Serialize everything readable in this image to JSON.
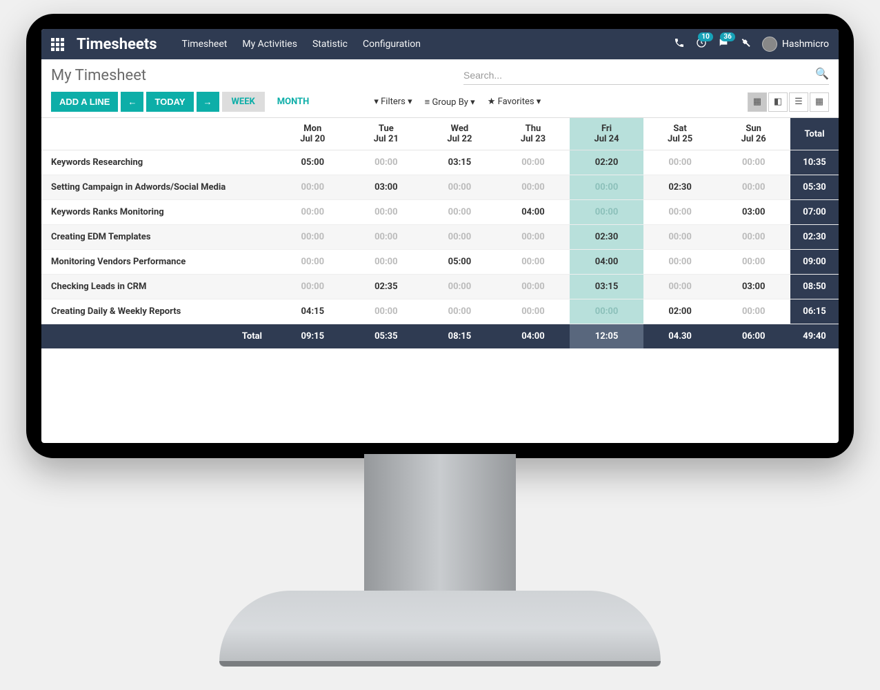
{
  "nav": {
    "appName": "Timesheets",
    "links": [
      "Timesheet",
      "My Activities",
      "Statistic",
      "Configuration"
    ],
    "clockBadge": "10",
    "chatBadge": "36",
    "userName": "Hashmicro"
  },
  "page": {
    "title": "My Timesheet",
    "searchPlaceholder": "Search...",
    "addLine": "ADD A LINE",
    "today": "TODAY",
    "periodWeek": "WEEK",
    "periodMonth": "MONTH",
    "filters": "Filters",
    "groupBy": "Group By",
    "favorites": "Favorites"
  },
  "days": [
    {
      "name": "Mon",
      "date": "Jul 20",
      "hl": false
    },
    {
      "name": "Tue",
      "date": "Jul 21",
      "hl": false
    },
    {
      "name": "Wed",
      "date": "Jul 22",
      "hl": false
    },
    {
      "name": "Thu",
      "date": "Jul 23",
      "hl": false
    },
    {
      "name": "Fri",
      "date": "Jul 24",
      "hl": true
    },
    {
      "name": "Sat",
      "date": "Jul 25",
      "hl": false
    },
    {
      "name": "Sun",
      "date": "Jul 26",
      "hl": false
    }
  ],
  "totalLabel": "Total",
  "rows": [
    {
      "task": "Keywords Researching",
      "cells": [
        "05:00",
        "00:00",
        "03:15",
        "00:00",
        "02:20",
        "00:00",
        "00:00"
      ],
      "total": "10:35"
    },
    {
      "task": "Setting Campaign in Adwords/Social Media",
      "cells": [
        "00:00",
        "03:00",
        "00:00",
        "00:00",
        "00:00",
        "02:30",
        "00:00"
      ],
      "total": "05:30"
    },
    {
      "task": "Keywords Ranks Monitoring",
      "cells": [
        "00:00",
        "00:00",
        "00:00",
        "04:00",
        "00:00",
        "00:00",
        "03:00"
      ],
      "total": "07:00"
    },
    {
      "task": "Creating EDM Templates",
      "cells": [
        "00:00",
        "00:00",
        "00:00",
        "00:00",
        "02:30",
        "00:00",
        "00:00"
      ],
      "total": "02:30"
    },
    {
      "task": "Monitoring Vendors Performance",
      "cells": [
        "00:00",
        "00:00",
        "05:00",
        "00:00",
        "04:00",
        "00:00",
        "00:00"
      ],
      "total": "09:00"
    },
    {
      "task": "Checking Leads in CRM",
      "cells": [
        "00:00",
        "02:35",
        "00:00",
        "00:00",
        "03:15",
        "00:00",
        "03:00"
      ],
      "total": "08:50"
    },
    {
      "task": "Creating Daily & Weekly Reports",
      "cells": [
        "04:15",
        "00:00",
        "00:00",
        "00:00",
        "00:00",
        "02:00",
        "00:00"
      ],
      "total": "06:15"
    }
  ],
  "footer": {
    "label": "Total",
    "cells": [
      "09:15",
      "05:35",
      "08:15",
      "04:00",
      "12:05",
      "04.30",
      "06:00"
    ],
    "grand": "49:40"
  }
}
